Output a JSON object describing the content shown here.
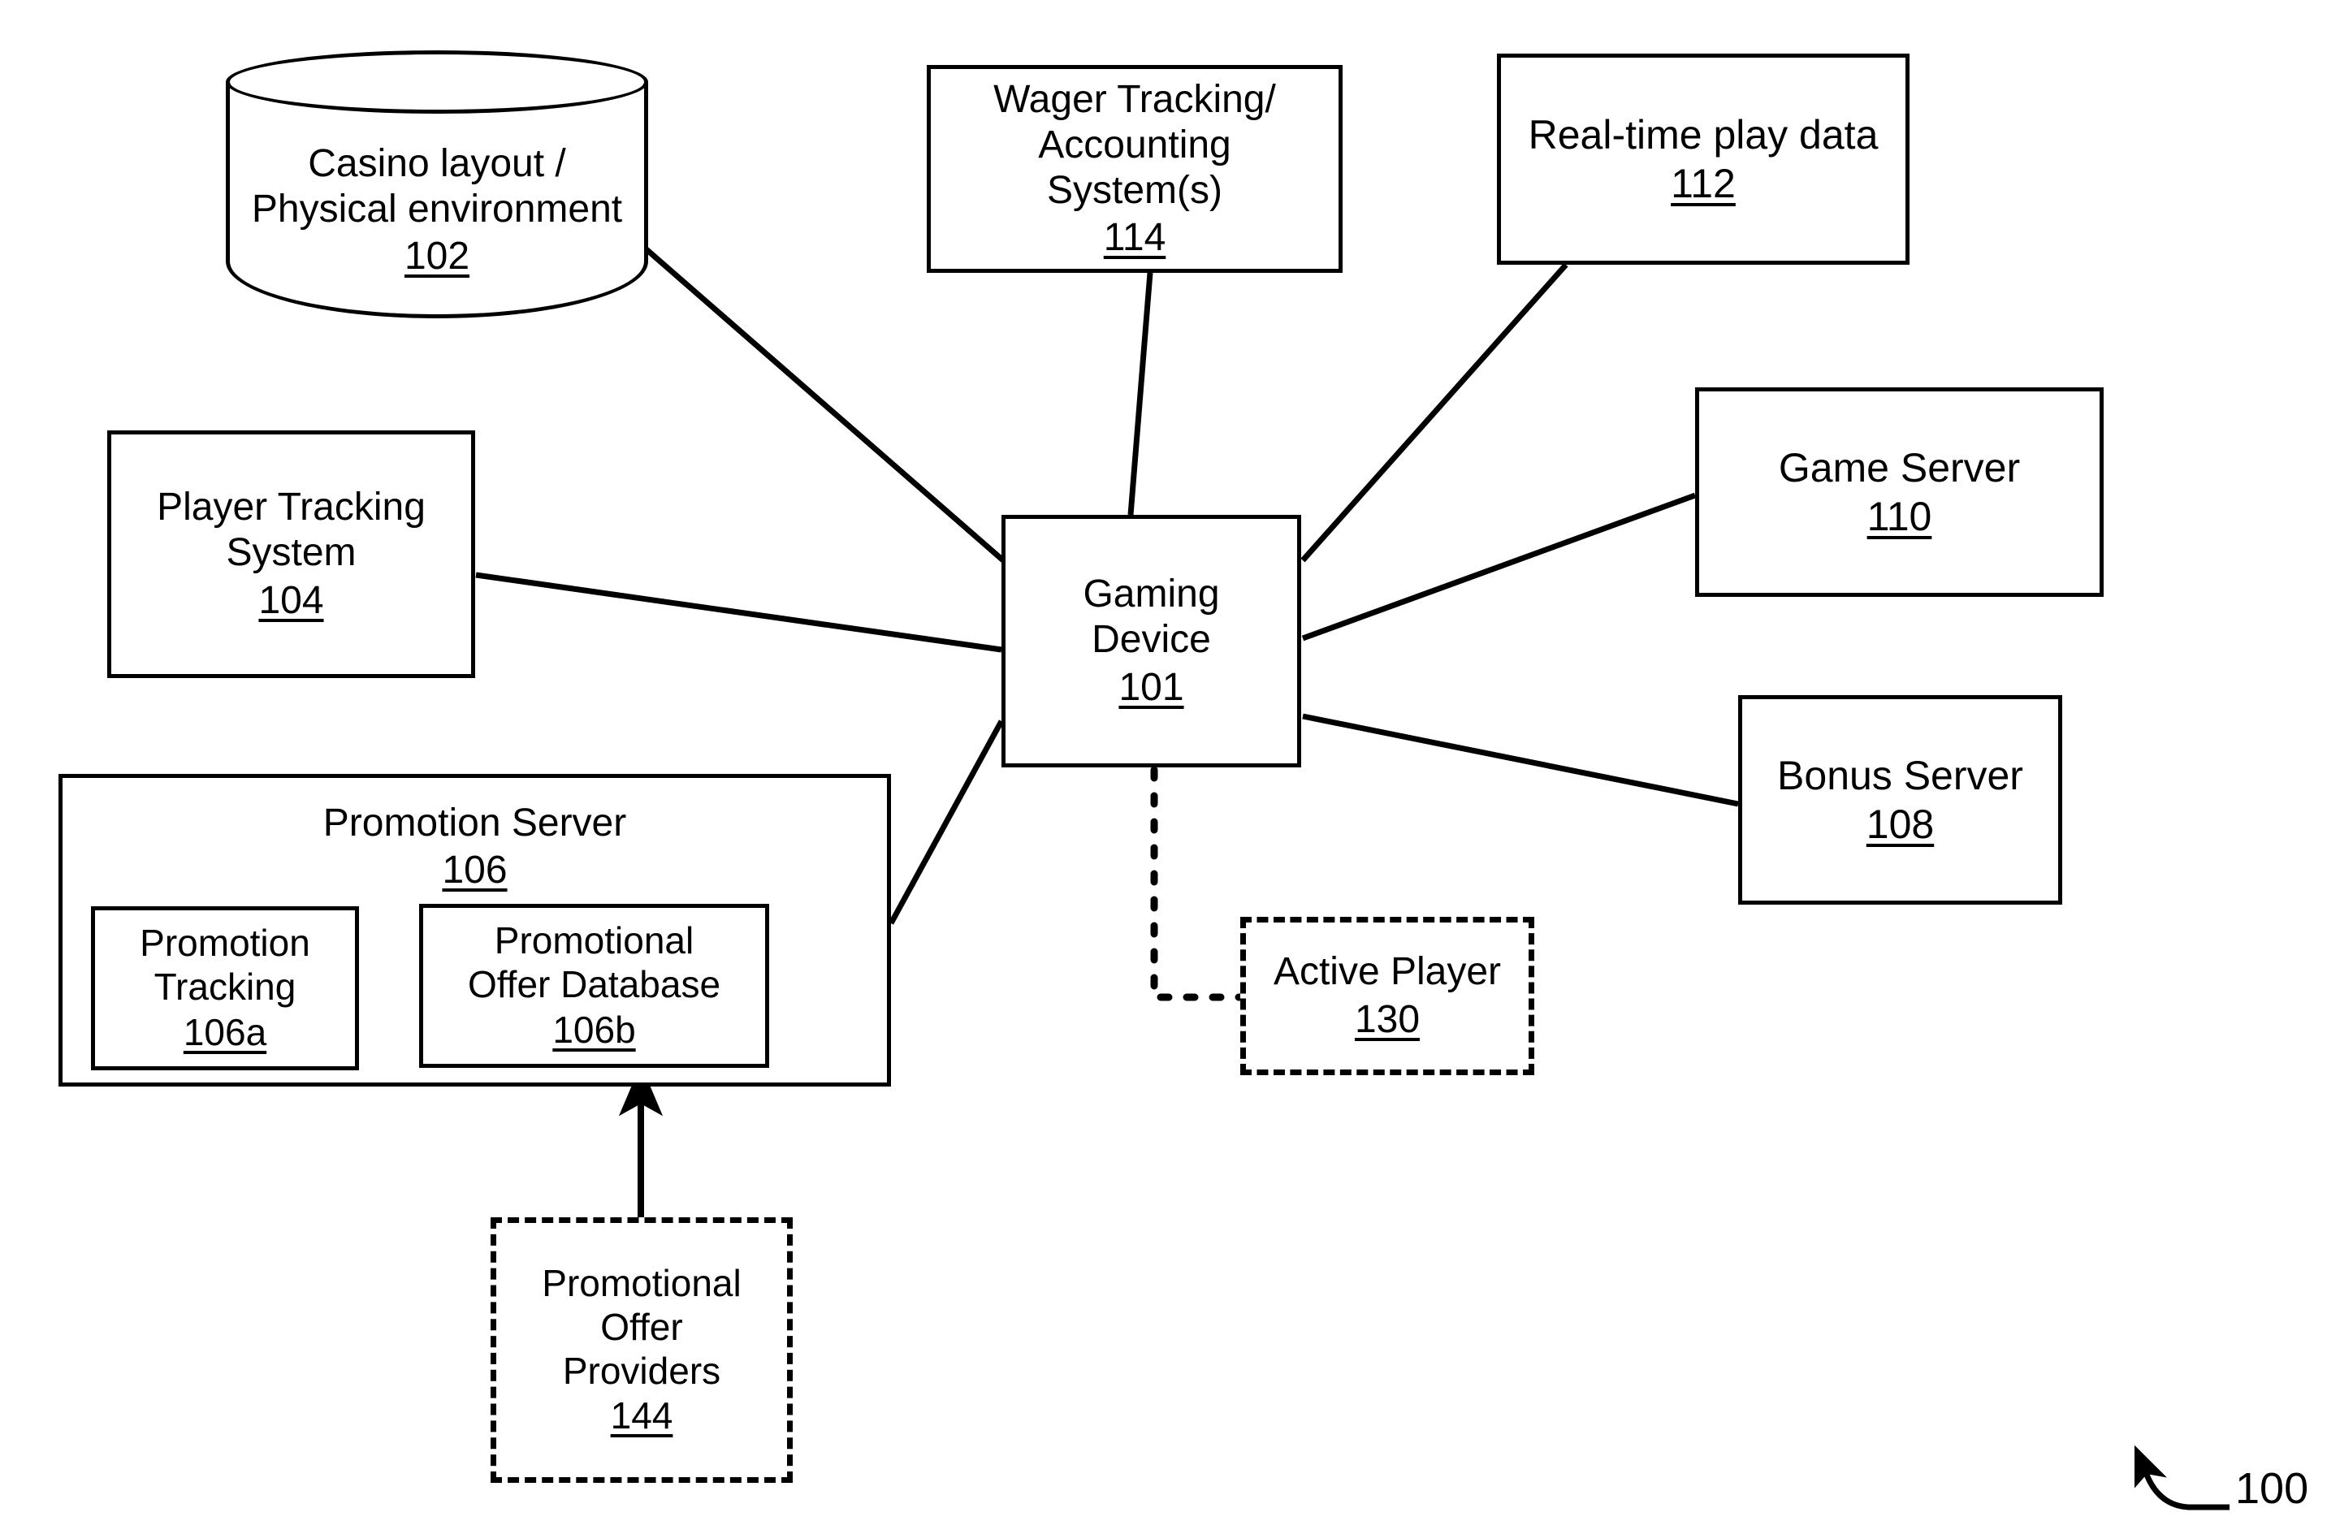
{
  "figure": {
    "number": "100",
    "callout_icon": "curved-arrow-icon"
  },
  "nodes": {
    "casino_layout": {
      "shape": "cylinder",
      "lines": [
        "Casino layout /",
        "Physical environment"
      ],
      "ref": "102"
    },
    "wager_tracking": {
      "shape": "rect",
      "lines": [
        "Wager Tracking/",
        "Accounting",
        "System(s)"
      ],
      "ref": "114"
    },
    "realtime_play_data": {
      "shape": "rect",
      "lines": [
        "Real-time play data"
      ],
      "ref": "112"
    },
    "game_server": {
      "shape": "rect",
      "lines": [
        "Game Server"
      ],
      "ref": "110"
    },
    "bonus_server": {
      "shape": "rect",
      "lines": [
        "Bonus Server"
      ],
      "ref": "108"
    },
    "player_tracking_system": {
      "shape": "rect",
      "lines": [
        "Player Tracking",
        "System"
      ],
      "ref": "104"
    },
    "gaming_device": {
      "shape": "rect",
      "lines": [
        "Gaming",
        "Device"
      ],
      "ref": "101"
    },
    "active_player": {
      "shape": "dashed-rect",
      "lines": [
        "Active Player"
      ],
      "ref": "130"
    },
    "promotion_server": {
      "shape": "rect-group",
      "lines": [
        "Promotion Server"
      ],
      "ref": "106"
    },
    "promotion_tracking": {
      "shape": "rect",
      "lines": [
        "Promotion",
        "Tracking"
      ],
      "ref": "106a"
    },
    "promotional_offer_database": {
      "shape": "rect",
      "lines": [
        "Promotional",
        "Offer Database"
      ],
      "ref": "106b"
    },
    "promotional_offer_providers": {
      "shape": "dashed-rect",
      "lines": [
        "Promotional",
        "Offer",
        "Providers"
      ],
      "ref": "144"
    }
  },
  "connections": [
    {
      "from": "casino_layout",
      "to": "gaming_device",
      "style": "solid"
    },
    {
      "from": "wager_tracking",
      "to": "gaming_device",
      "style": "solid"
    },
    {
      "from": "realtime_play_data",
      "to": "gaming_device",
      "style": "solid"
    },
    {
      "from": "game_server",
      "to": "gaming_device",
      "style": "solid"
    },
    {
      "from": "bonus_server",
      "to": "gaming_device",
      "style": "solid"
    },
    {
      "from": "player_tracking_system",
      "to": "gaming_device",
      "style": "solid"
    },
    {
      "from": "promotion_server",
      "to": "gaming_device",
      "style": "solid"
    },
    {
      "from": "gaming_device",
      "to": "active_player",
      "style": "dotted"
    },
    {
      "from": "promotional_offer_providers",
      "to": "promotional_offer_database",
      "style": "solid-arrow"
    }
  ],
  "colors": {
    "line": "#000000",
    "background": "#ffffff",
    "text": "#000000"
  }
}
